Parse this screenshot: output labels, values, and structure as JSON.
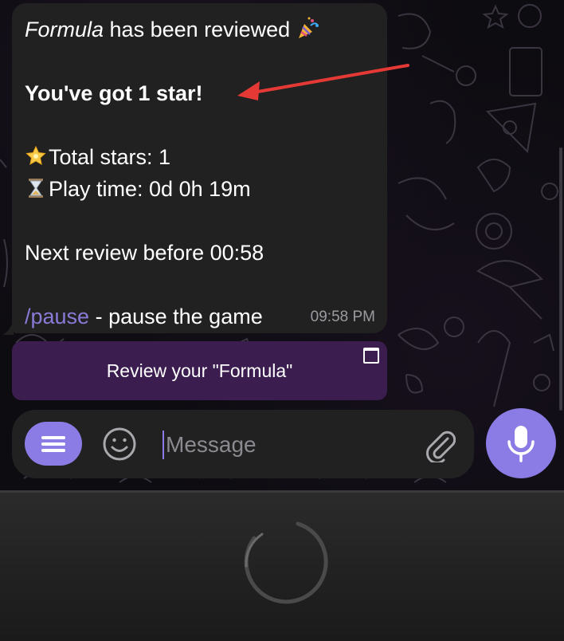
{
  "message": {
    "game_name": "Formula",
    "reviewed_text": " has been reviewed",
    "stars_line": "You've got 1 star!",
    "total_stars": "Total stars: 1",
    "play_time": "Play time: 0d 0h 19m",
    "next_review": "Next review before 00:58",
    "pause_command": "/pause",
    "pause_text": " - pause the game",
    "time": "09:58 PM"
  },
  "keyboard_button": {
    "label": "Review your \"Formula\""
  },
  "input": {
    "placeholder": "Message"
  },
  "icons": {
    "party": "party-popper-icon",
    "star": "glowing-star-icon",
    "hourglass": "hourglass-icon",
    "menu": "menu-icon",
    "emoji": "smiley-icon",
    "attach": "paperclip-icon",
    "mic": "microphone-icon"
  },
  "colors": {
    "accent": "#8b7be5",
    "link": "#8b7bd8",
    "bubble": "#212121",
    "keyboard_button": "#3b1d4f",
    "annotation_arrow": "#e53935"
  }
}
